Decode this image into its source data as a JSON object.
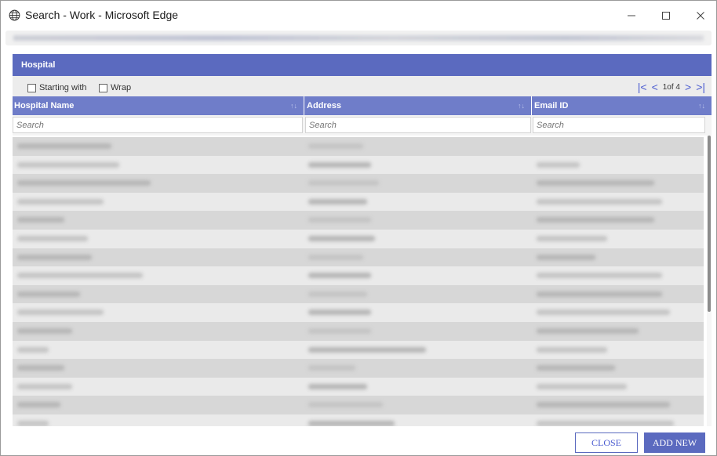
{
  "window": {
    "title": "Search - Work - Microsoft Edge",
    "icon": "globe-icon"
  },
  "dialog": {
    "header": "Hospital",
    "options": {
      "starting_with_label": "Starting with",
      "wrap_label": "Wrap"
    },
    "pager": {
      "first_icon": "first-page-icon",
      "prev_icon": "prev-page-icon",
      "page_text": "1of 4",
      "next_icon": "next-page-icon",
      "last_icon": "last-page-icon"
    },
    "columns": [
      {
        "label": "Hospital Name",
        "sort_icon": "↑↓"
      },
      {
        "label": "Address",
        "sort_icon": "↑↓"
      },
      {
        "label": "Email ID",
        "sort_icon": "↑↓"
      }
    ],
    "search_placeholders": {
      "name": "Search",
      "address": "Search",
      "email": "Search"
    },
    "row_count_visible": 16,
    "colors": {
      "header_bg": "#5b6abf",
      "column_header_bg": "#6f7dc9",
      "pager_accent": "#4a5bd0"
    },
    "buttons": {
      "close_label": "CLOSE",
      "add_new_label": "ADD NEW"
    }
  }
}
